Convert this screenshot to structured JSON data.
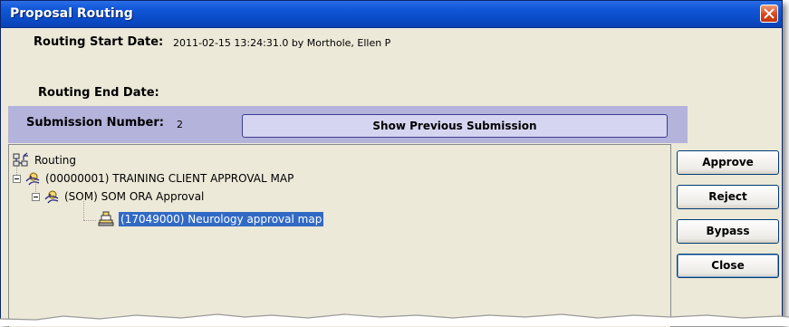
{
  "window": {
    "title": "Proposal Routing"
  },
  "info": {
    "start_label": "Routing Start Date:",
    "start_value": "2011-02-15 13:24:31.0 by Morthole, Ellen P",
    "end_label": "Routing End Date:",
    "submission_label": "Submission Number:",
    "submission_value": "2"
  },
  "show_previous_label": "Show Previous Submission",
  "tree": {
    "root": "Routing",
    "node1": "(00000001) TRAINING CLIENT APPROVAL MAP",
    "node2": "(SOM) SOM ORA Approval",
    "node3": "(17049000) Neurology approval map"
  },
  "buttons": {
    "approve": "Approve",
    "reject": "Reject",
    "bypass": "Bypass",
    "close": "Close"
  },
  "colors": {
    "titlebar": "#0a4bc7",
    "dialog_bg": "#ece9d8",
    "submission_band": "#b4b3dc",
    "selection": "#316ac5"
  }
}
